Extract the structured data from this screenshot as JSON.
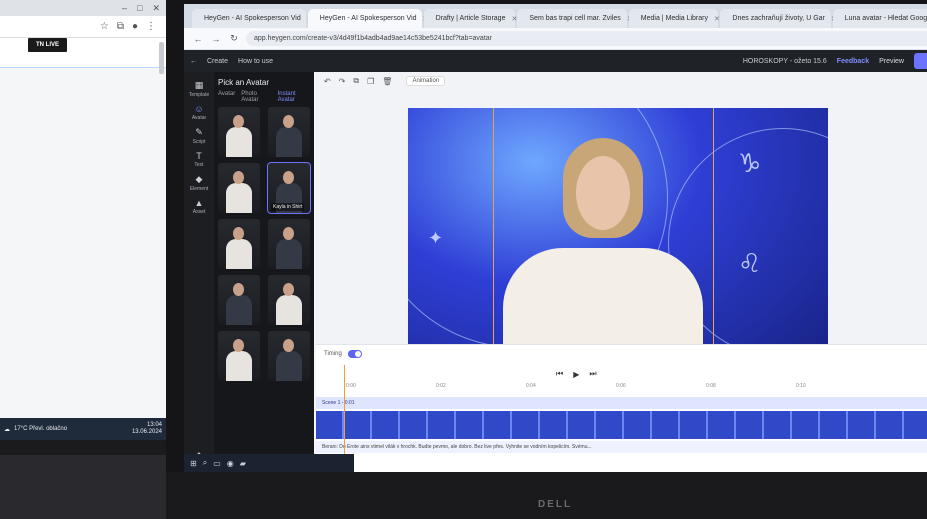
{
  "left_screen": {
    "logo_text": "TN LIVE",
    "weather": "17°C  Převl. oblačno",
    "clock_time": "13:04",
    "clock_date": "13.06.2024"
  },
  "browser": {
    "tabs": [
      {
        "label": "HeyGen - AI Spokesperson Vid",
        "active": false
      },
      {
        "label": "HeyGen - AI Spokesperson Vid",
        "active": true
      },
      {
        "label": "Drafty | Article Storage",
        "active": false
      },
      {
        "label": "Sem bas trapi cell mar. Zviles",
        "active": false
      },
      {
        "label": "Media | Media Library",
        "active": false
      },
      {
        "label": "Dnes zachraňují životy, U Gar",
        "active": false
      },
      {
        "label": "Luna avatar - Hledat Googlem",
        "active": false
      }
    ],
    "url": "app.heygen.com/create-v3/4d49f1b4adb4ad9ae14c53be5241bcf?tab=avatar",
    "toolbar": {
      "create_label": "Create",
      "how_to_use_label": "How to use"
    }
  },
  "app_header": {
    "project_title": "HOROSKOPY - ožeto 15.6",
    "feedback_label": "Feedback",
    "preview_label": "Preview"
  },
  "rail": {
    "items": [
      {
        "label": "Template",
        "glyph": "▦"
      },
      {
        "label": "Avatar",
        "glyph": "☺"
      },
      {
        "label": "Script",
        "glyph": "✎"
      },
      {
        "label": "Text",
        "glyph": "T"
      },
      {
        "label": "Element",
        "glyph": "◆"
      },
      {
        "label": "Asset",
        "glyph": "▲"
      }
    ],
    "pricing_label": "Pricing"
  },
  "avatar_panel": {
    "title": "Pick an Avatar",
    "subtabs": [
      "Avatar",
      "Photo Avatar",
      "Instant Avatar"
    ],
    "selected_caption": "Kayla in Shirt"
  },
  "canvas": {
    "animation_label": "Animation"
  },
  "timeline": {
    "timing_label": "Timing",
    "ruler_marks": [
      "0:00",
      "0:02",
      "0:04",
      "0:06",
      "0:08",
      "0:10"
    ],
    "scene_label": "Scene 1 - 0:01",
    "script_text": "Berani: Do Erote ains vtimel vilák v hrochk. Budte pevmo, ale dobro. Bez live přes. Vyhnite se vodním kopelicím. Svému..."
  },
  "colors": {
    "accent": "#6b73ff",
    "playhead": "#f0a030",
    "video_bg": "#2f3fd6"
  }
}
